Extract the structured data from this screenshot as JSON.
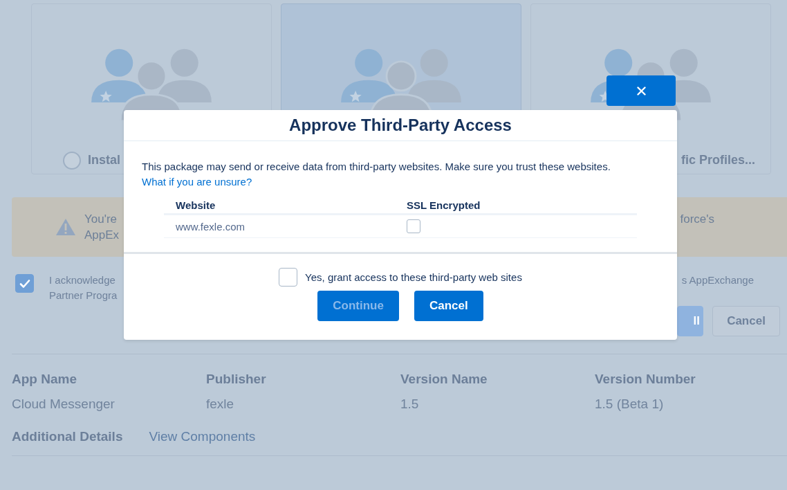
{
  "background": {
    "install_options": [
      {
        "kind": "radio-label",
        "label": "Instal",
        "selected": false
      },
      {
        "kind": "icon-only",
        "selected": true
      },
      {
        "kind": "label-only",
        "label": "fic Profiles...",
        "selected": false
      }
    ],
    "warning": {
      "left_lines": [
        "You're",
        "AppEx"
      ],
      "right_text": "force's"
    },
    "acknowledge": {
      "checked": true,
      "left_lines": [
        "I acknowledge",
        "Partner Progra"
      ],
      "right_text": "s AppExchange"
    },
    "buttons": [
      {
        "label": "ll",
        "kind": "brand"
      },
      {
        "label": "Cancel",
        "kind": "neutral"
      }
    ],
    "details": [
      {
        "label": "App Name",
        "value": "Cloud Messenger"
      },
      {
        "label": "Publisher",
        "value": "fexle"
      },
      {
        "label": "Version Name",
        "value": "1.5"
      },
      {
        "label": "Version Number",
        "value": "1.5 (Beta 1)"
      }
    ],
    "tabs": [
      {
        "label": "Additional Details",
        "selected": true
      },
      {
        "label": "View Components",
        "selected": false
      }
    ]
  },
  "modal": {
    "title": "Approve Third-Party Access",
    "message": "This package may send or receive data from third-party websites. Make sure you trust these websites.",
    "link": "What if you are unsure?",
    "table": {
      "columns": [
        "Website",
        "SSL Encrypted"
      ],
      "rows": [
        {
          "website": "www.fexle.com",
          "ssl_encrypted": false
        }
      ]
    },
    "grant": {
      "label": "Yes, grant access to these third-party web sites",
      "checked": false
    },
    "buttons": [
      {
        "label": "Continue",
        "disabled": true
      },
      {
        "label": "Cancel",
        "disabled": false
      }
    ]
  }
}
